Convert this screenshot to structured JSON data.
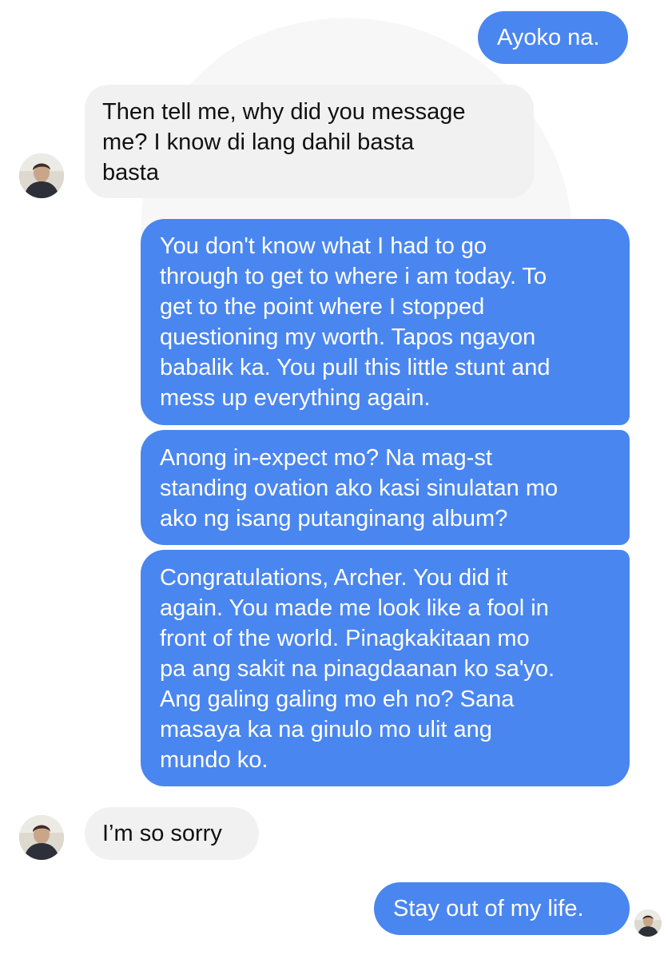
{
  "colors": {
    "sent_bubble": "#4a86ef",
    "received_bubble": "#f1f1f1",
    "sent_text": "#ffffff",
    "received_text": "#111111"
  },
  "avatar": {
    "icon": "profile-photo-icon"
  },
  "messages": [
    {
      "id": 1,
      "sender": "me",
      "text": "Ayoko na."
    },
    {
      "id": 2,
      "sender": "contact",
      "text": "Then tell me, why did you message\nme? I know di lang dahil basta\nbasta"
    },
    {
      "id": 3,
      "sender": "me",
      "text": "You don't know what I had to go\nthrough to get to where i am today. To\nget to the point where I stopped\nquestioning my worth. Tapos ngayon\nbabalik ka. You pull this little stunt and\nmess up everything again."
    },
    {
      "id": 4,
      "sender": "me",
      "text": "Anong in-expect mo? Na mag-st\nstanding ovation ako kasi sinulatan mo\nako ng isang putanginang album?"
    },
    {
      "id": 5,
      "sender": "me",
      "text": "Congratulations, Archer. You did it\nagain. You made me look like a fool in\nfront of the world. Pinagkakitaan mo\npa ang sakit na pinagdaanan ko sa'yo.\nAng galing galing mo eh no? Sana\nmasaya ka na ginulo mo ulit ang\nmundo ko."
    },
    {
      "id": 6,
      "sender": "contact",
      "text": "I’m so sorry"
    },
    {
      "id": 7,
      "sender": "me",
      "text": "Stay out of my life."
    }
  ]
}
